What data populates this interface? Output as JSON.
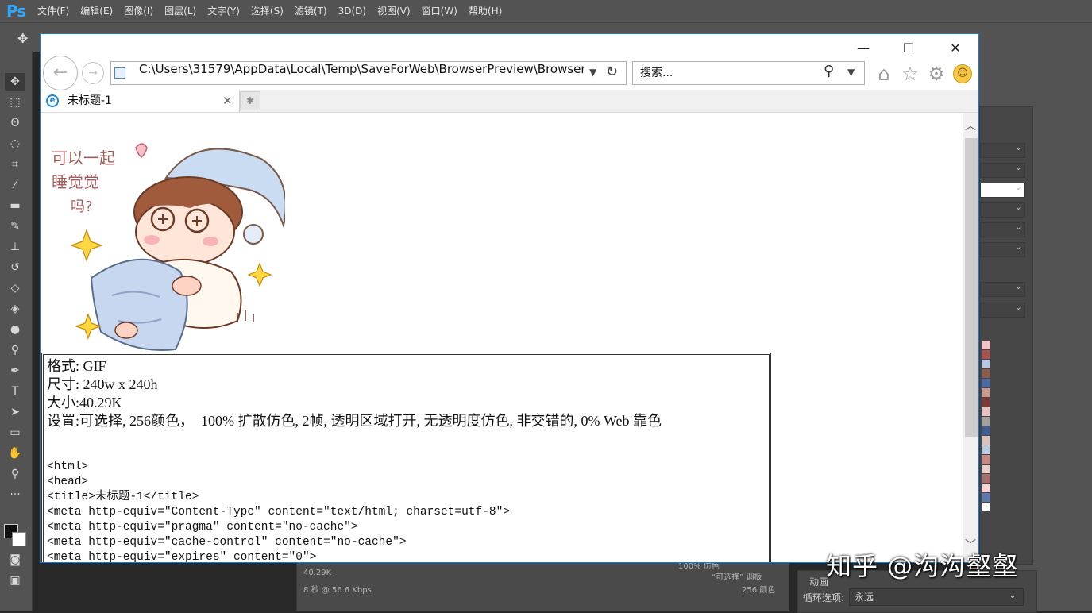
{
  "ps": {
    "logo": "Ps",
    "menu": [
      "文件(F)",
      "编辑(E)",
      "图像(I)",
      "图层(L)",
      "文字(Y)",
      "选择(S)",
      "滤镜(T)",
      "3D(D)",
      "视图(V)",
      "窗口(W)",
      "帮助(H)"
    ],
    "status": {
      "size": "40.29K",
      "time": "8 秒 @ 56.6 Kbps",
      "dither": "100% 仿色",
      "palette": "“可选择” 调板",
      "colors": "256 颜色"
    },
    "animation": {
      "title": "动画",
      "loop_label": "循环选项:",
      "loop_value": "永远"
    },
    "swatch_colors": [
      "#f3c3c8",
      "#a55353",
      "#b7c8e2",
      "#8a5c4b",
      "#4d6aa3",
      "#c89a90",
      "#7a3a3a",
      "#e9c2c2",
      "#a0a0a0",
      "#3f5b8f",
      "#d8c2be",
      "#bcc9dc",
      "#c38883",
      "#e7d0cc",
      "#a56e6e",
      "#f5d4d4",
      "#6078aa",
      "#ffffff"
    ]
  },
  "browser": {
    "window_controls": {
      "minimize": "—",
      "maximize": "☐",
      "close": "✕"
    },
    "address": "C:\\Users\\31579\\AppData\\Local\\Temp\\SaveForWeb\\BrowserPreview\\Browser",
    "search_placeholder": "搜索...",
    "tab_title": "未标题-1",
    "content": {
      "sticker_text": [
        "可以一起",
        "睡觉觉",
        "吗?"
      ],
      "info_lines": [
        "格式: GIF",
        "尺寸: 240w x 240h",
        "大小:40.29K",
        "设置:可选择, 256颜色，  100% 扩散仿色, 2帧, 透明区域打开, 无透明度仿色, 非交错的, 0% Web 靠色"
      ],
      "code_lines": [
        "<html>",
        "<head>",
        "<title>未标题-1</title>",
        "<meta http-equiv=\"Content-Type\" content=\"text/html; charset=utf-8\">",
        "<meta http-equiv=\"pragma\" content=\"no-cache\">",
        "<meta http-equiv=\"cache-control\" content=\"no-cache\">",
        "<meta http-equiv=\"expires\" content=\"0\">"
      ]
    }
  },
  "watermark": "知乎 @沟沟壑壑"
}
